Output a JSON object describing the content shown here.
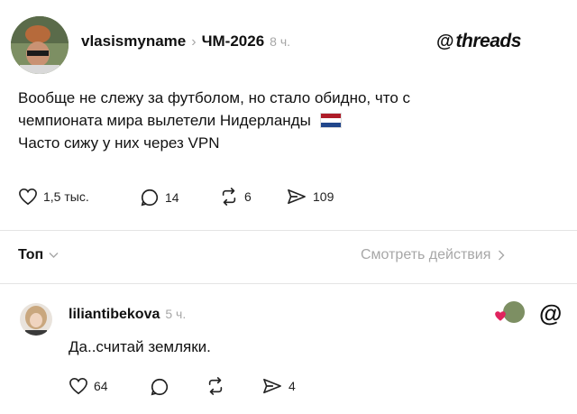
{
  "post": {
    "username": "vlasismyname",
    "separator": "›",
    "topic": "ЧМ-2026",
    "time": "8 ч.",
    "brand": "threads",
    "lines": [
      "Вообще не слежу за футболом, но стало обидно, что с",
      "чемпионата мира вылетели Нидерланды",
      "Часто сижу у них через VPN"
    ],
    "flag_colors": [
      "#ae1c28",
      "#ffffff",
      "#21468b"
    ],
    "likes": "1,5 тыс.",
    "replies": "14",
    "reposts": "6",
    "shares": "109"
  },
  "sort": {
    "label": "Топ",
    "view_activity": "Смотреть действия"
  },
  "reply": {
    "username": "liliantibekova",
    "time": "5 ч.",
    "text": "Да..считай земляки.",
    "likes": "64",
    "shares": "4",
    "like_color": "#e0245e"
  }
}
